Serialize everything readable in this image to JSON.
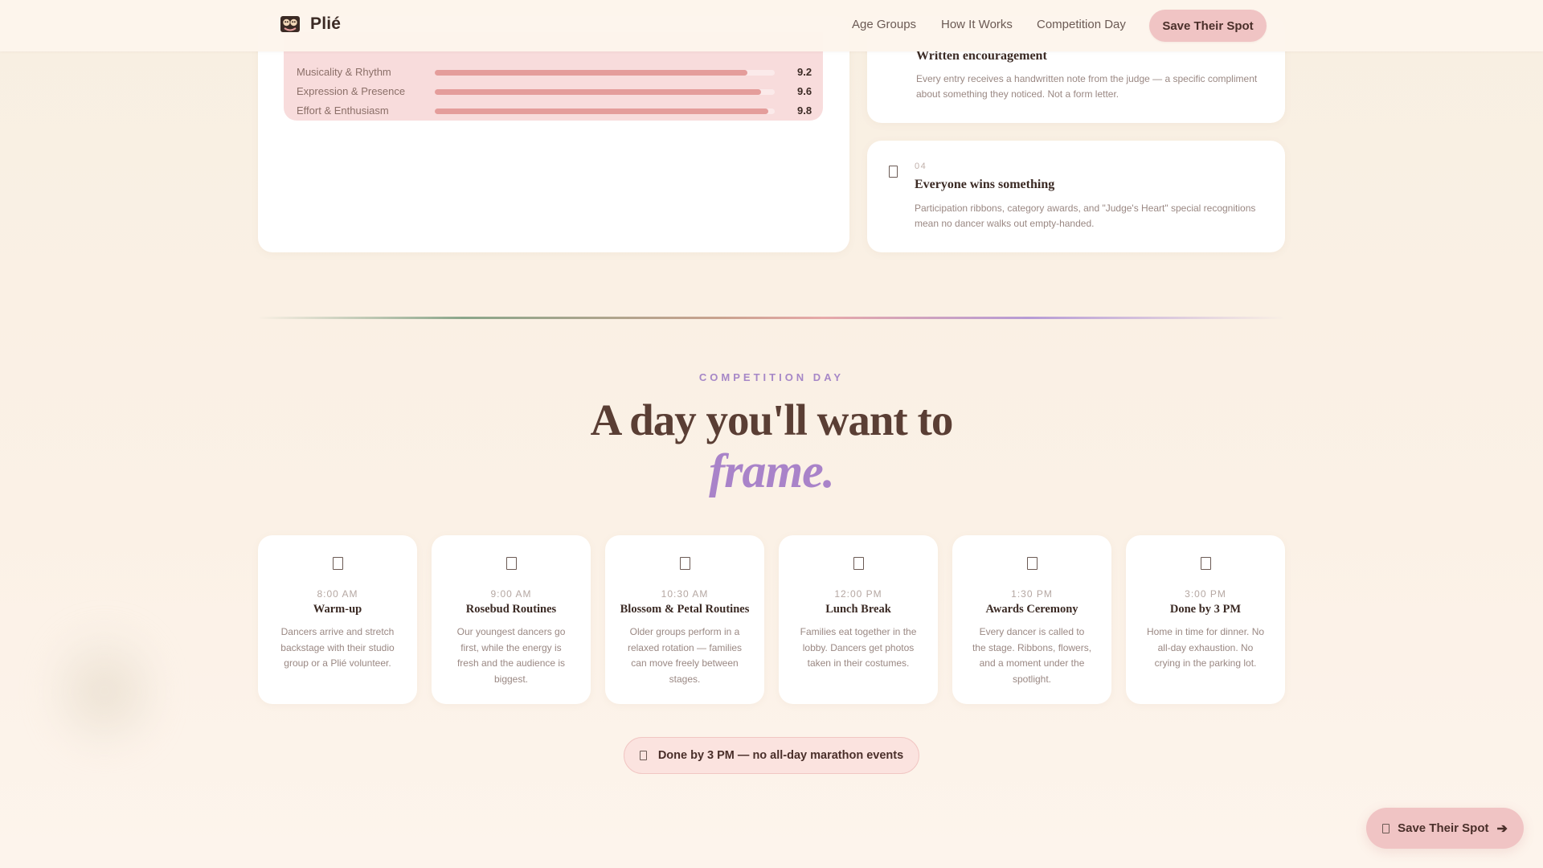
{
  "header": {
    "brand": "Plié",
    "nav": [
      "Age Groups",
      "How It Works",
      "Competition Day"
    ],
    "cta_label": "Save Their Spot"
  },
  "scores": [
    {
      "label": "Musicality & Rhythm",
      "value": "9.2",
      "fraction": 0.92
    },
    {
      "label": "Expression & Presence",
      "value": "9.6",
      "fraction": 0.96
    },
    {
      "label": "Effort & Enthusiasm",
      "value": "9.8",
      "fraction": 0.98
    }
  ],
  "features": [
    {
      "number": "",
      "title": "Written encouragement",
      "desc": "Every entry receives a handwritten note from the judge — a specific compliment about something they noticed. Not a form letter."
    },
    {
      "number": "04",
      "title": "Everyone wins something",
      "desc": "Participation ribbons, category awards, and \"Judge's Heart\" special recognitions mean no dancer walks out empty-handed."
    }
  ],
  "section": {
    "eyebrow": "COMPETITION DAY",
    "headline": "A day you'll want to",
    "accent": "frame."
  },
  "schedule": [
    {
      "time": "8:00 AM",
      "title": "Warm-up",
      "desc": "Dancers arrive and stretch backstage with their studio group or a Plié volunteer."
    },
    {
      "time": "9:00 AM",
      "title": "Rosebud Routines",
      "desc": "Our youngest dancers go first, while the energy is fresh and the audience is biggest."
    },
    {
      "time": "10:30 AM",
      "title": "Blossom & Petal Routines",
      "desc": "Older groups perform in a relaxed rotation — families can move freely between stages."
    },
    {
      "time": "12:00 PM",
      "title": "Lunch Break",
      "desc": "Families eat together in the lobby. Dancers get photos taken in their costumes."
    },
    {
      "time": "1:30 PM",
      "title": "Awards Ceremony",
      "desc": "Every dancer is called to the stage. Ribbons, flowers, and a moment under the spotlight."
    },
    {
      "time": "3:00 PM",
      "title": "Done by 3 PM",
      "desc": "Home in time for dinner. No all-day exhaustion. No crying in the parking lot."
    }
  ],
  "pill_text": "Done by 3 PM — no all-day marathon events",
  "float_cta": {
    "label": "Save Their Spot",
    "arrow": "➔"
  },
  "colors": {
    "accent_pink": "#f0c4c4",
    "accent_purple": "#a983c9",
    "heading_brown": "#5a3e34"
  }
}
